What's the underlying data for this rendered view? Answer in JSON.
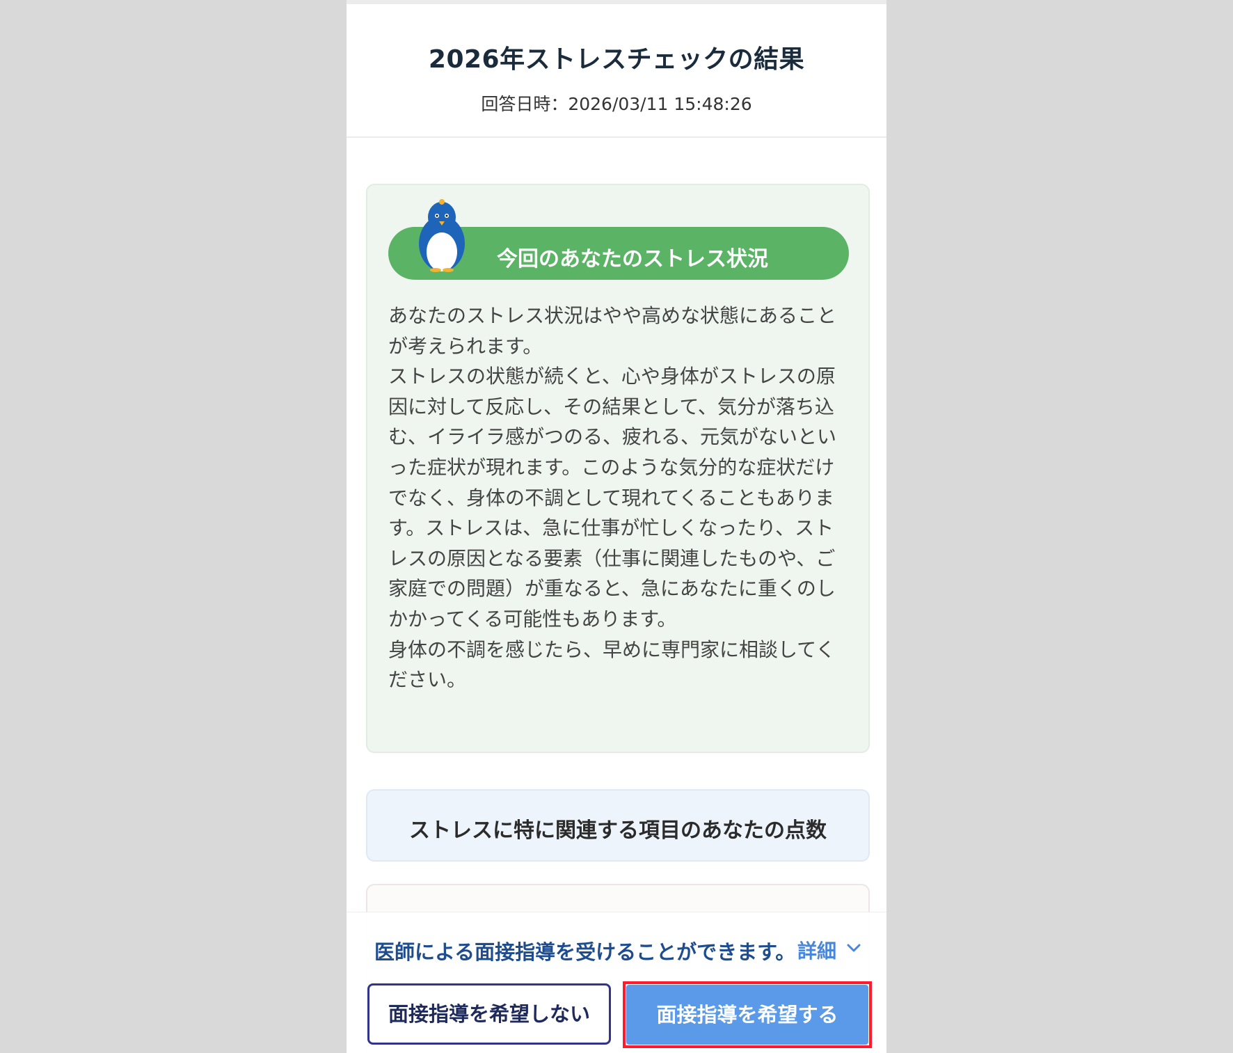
{
  "header": {
    "title": "2026年ストレスチェックの結果",
    "answer_date": "回答日時：2026/03/11 15:48:26"
  },
  "status_card": {
    "label": "今回のあなたのストレス状況",
    "text": "あなたのストレス状況はやや高めな状態にあることが考えられます。\nストレスの状態が続くと、心や身体がストレスの原因に対して反応し、その結果として、気分が落ち込む、イライラ感がつのる、疲れる、元気がないといった症状が現れます。このような気分的な症状だけでなく、身体の不調として現れてくることもあります。ストレスは、急に仕事が忙しくなったり、ストレスの原因となる要素（仕事に関連したものや、ご家庭での問題）が重なると、急にあなたに重くのしかかってくる可能性もあります。\n身体の不調を感じたら、早めに専門家に相談してください。",
    "mascot_icon": "penguin-icon",
    "pill_color": "#5bb466"
  },
  "score_card": {
    "title": "ストレスに特に関連する項目のあなたの点数"
  },
  "bottom_bar": {
    "notice": "医師による面接指導を受けることができます。",
    "details_label": "詳細",
    "details_icon": "chevron-down-icon",
    "decline_label": "面接指導を希望しない",
    "wish_label": "面接指導を希望する",
    "highlight_color": "#ff1a2e"
  }
}
